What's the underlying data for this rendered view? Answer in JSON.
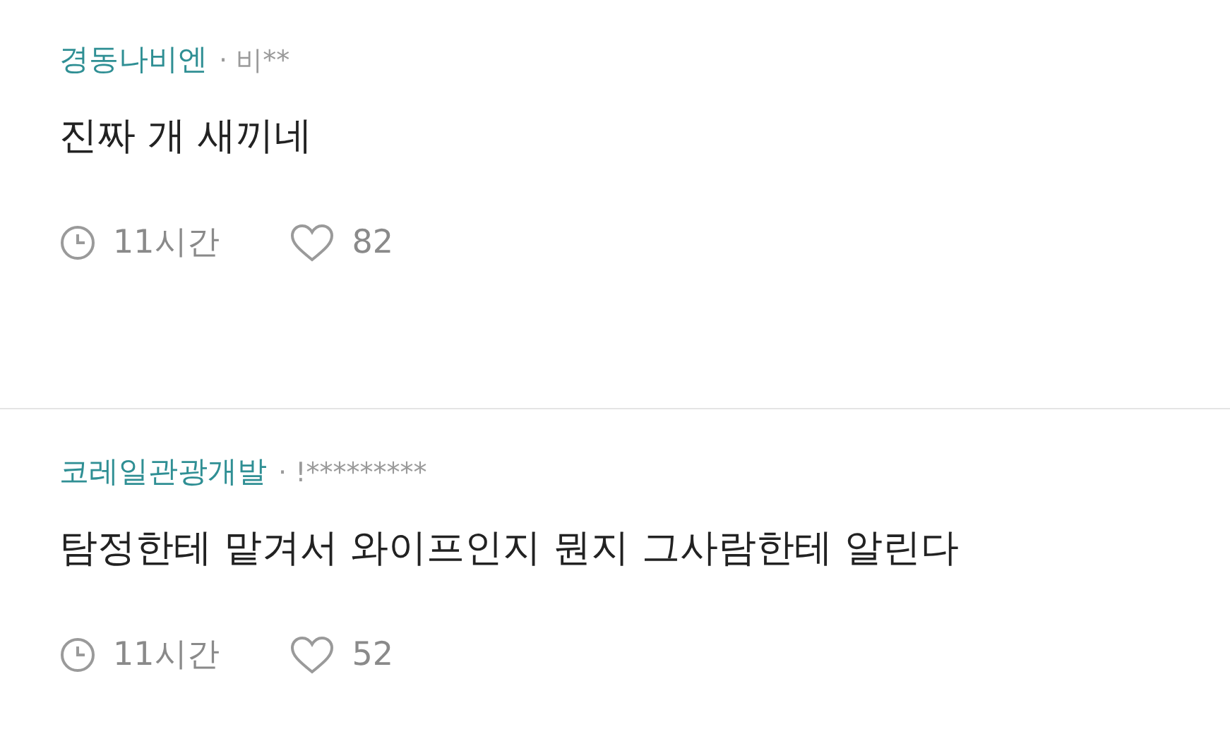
{
  "comments": [
    {
      "company": "경동나비엔",
      "author": "· 비**",
      "text": "진짜 개 새끼네",
      "time": "11시간",
      "likes": "82"
    },
    {
      "company": "코레일관광개발",
      "author": "· !*********",
      "text": "탐정한테 맡겨서 와이프인지 뭔지 그사람한테 알린다",
      "time": "11시간",
      "likes": "52"
    }
  ]
}
